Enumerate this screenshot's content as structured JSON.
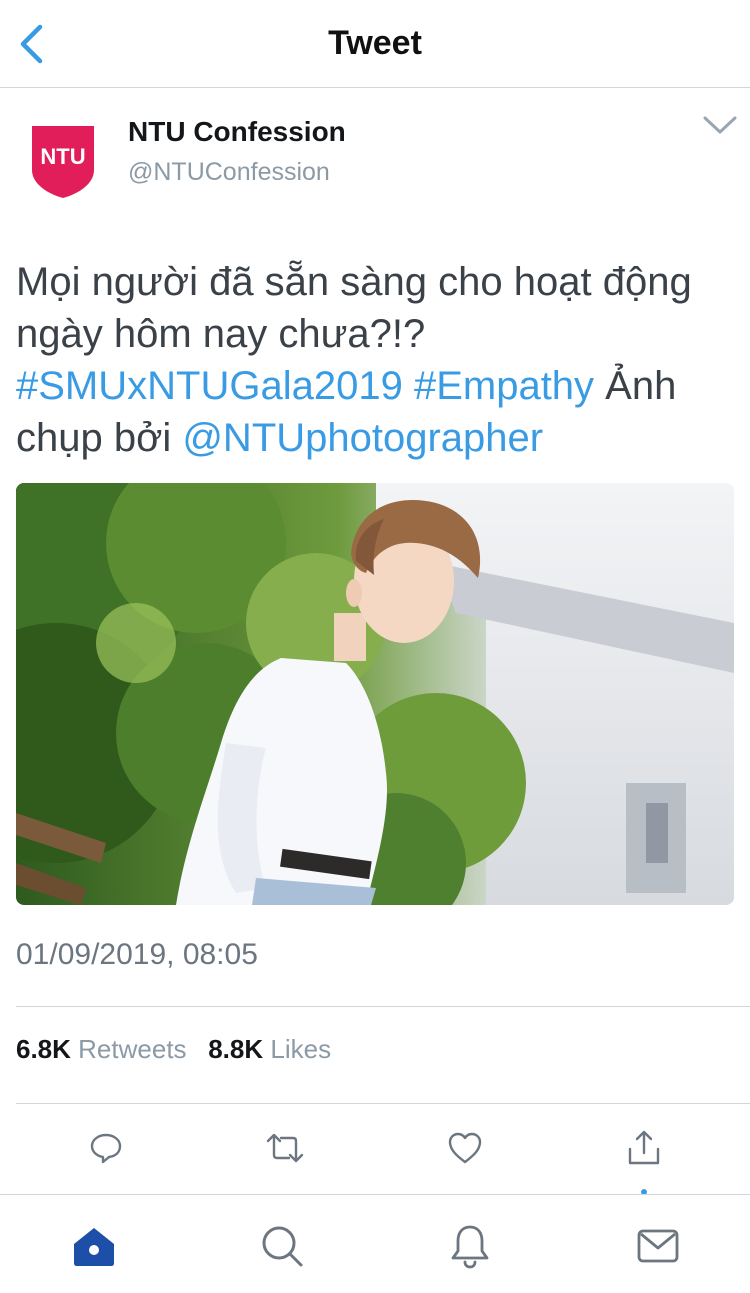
{
  "nav": {
    "title": "Tweet"
  },
  "author": {
    "avatar_text": "NTU",
    "name": "NTU Confession",
    "handle": "@NTUConfession"
  },
  "tweet": {
    "text_part1": "Mọi người đã sẵn sàng cho hoạt động ngày hôm nay chưa?!? ",
    "hashtag1": "#SMUxNTUGala2019",
    "hashtag2": "#Empathy",
    "text_part2": " Ảnh chụp bởi ",
    "mention": "@NTUphotographer",
    "timestamp": "01/09/2019, 08:05"
  },
  "stats": {
    "retweets_count": "6.8K",
    "retweets_label": "Retweets",
    "likes_count": "8.8K",
    "likes_label": "Likes"
  },
  "icons": {
    "back": "chevron-left-icon",
    "more": "chevron-down-icon",
    "reply": "speech-bubble-icon",
    "retweet": "retweet-icon",
    "like": "heart-icon",
    "share": "share-icon",
    "home": "home-icon",
    "search": "search-icon",
    "notifications": "bell-icon",
    "messages": "envelope-icon"
  },
  "colors": {
    "accent": "#1da1f2",
    "link": "#3a9be5",
    "brand": "#e11d5a"
  }
}
